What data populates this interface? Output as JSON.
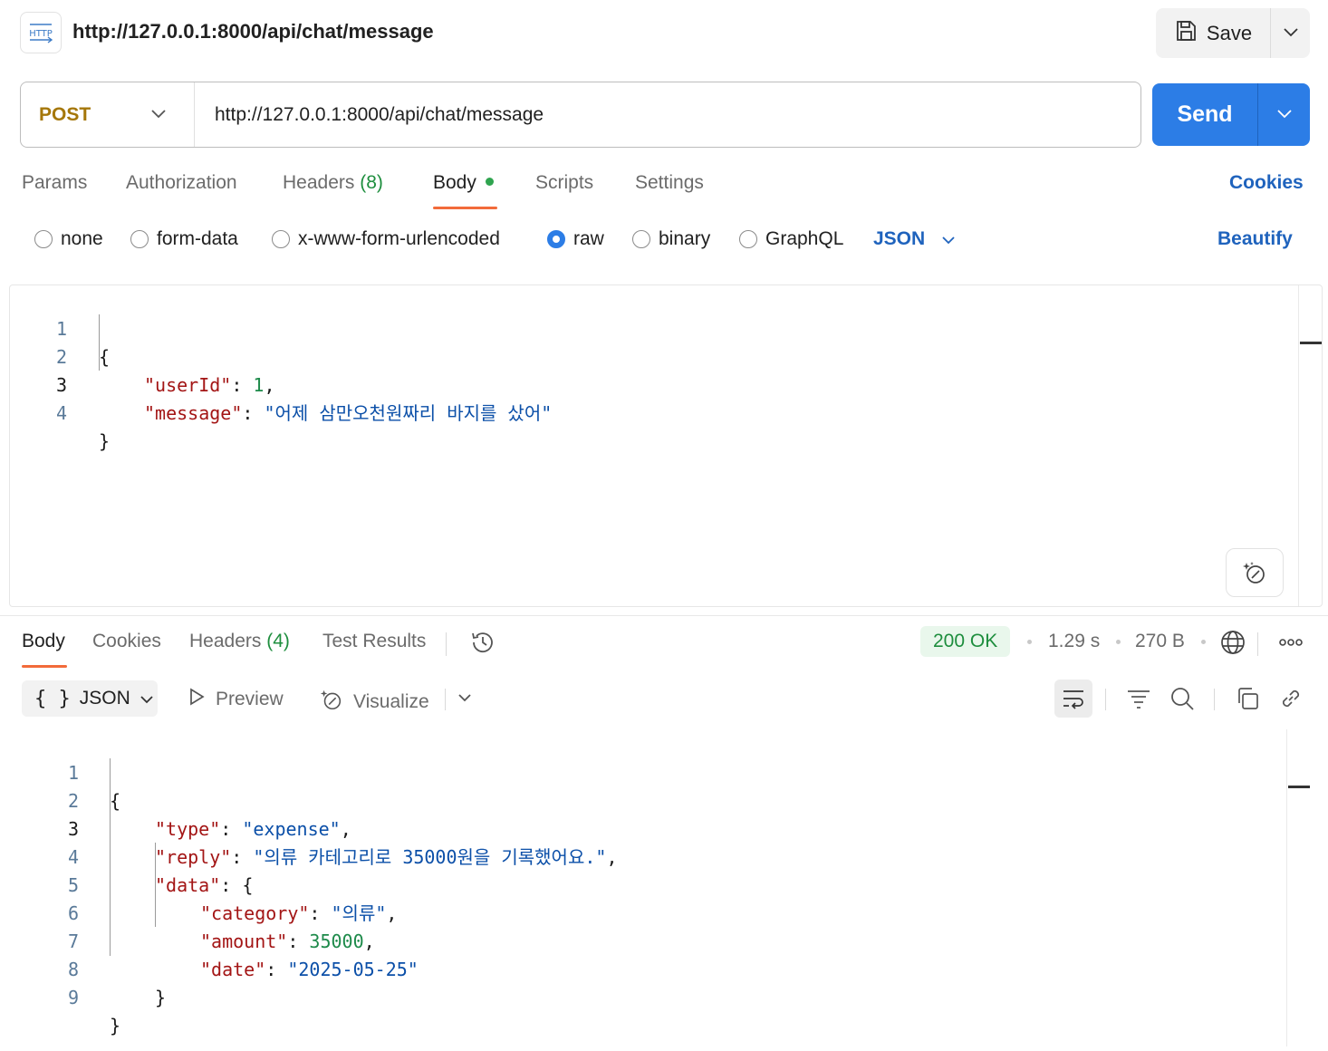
{
  "header": {
    "badge_label": "HTTP",
    "title": "http://127.0.0.1:8000/api/chat/message",
    "save_label": "Save"
  },
  "request": {
    "method": "POST",
    "url": "http://127.0.0.1:8000/api/chat/message",
    "send_label": "Send"
  },
  "request_tabs": {
    "params": "Params",
    "authorization": "Authorization",
    "headers": "Headers",
    "headers_count": "(8)",
    "body": "Body",
    "scripts": "Scripts",
    "settings": "Settings",
    "cookies": "Cookies"
  },
  "body_modes": {
    "none": "none",
    "form_data": "form-data",
    "urlencoded": "x-www-form-urlencoded",
    "raw": "raw",
    "binary": "binary",
    "graphql": "GraphQL",
    "selected": "raw",
    "language": "JSON",
    "beautify": "Beautify"
  },
  "request_body": {
    "line_numbers": [
      "1",
      "2",
      "3",
      "4"
    ],
    "brace_open": "{",
    "brace_close": "}",
    "key_userId": "\"userId\"",
    "val_userId": "1",
    "key_message": "\"message\"",
    "val_message": "\"어제 삼만오천원짜리 바지를 샀어\""
  },
  "response_tabs": {
    "body": "Body",
    "cookies": "Cookies",
    "headers": "Headers",
    "headers_count": "(4)",
    "test_results": "Test Results",
    "status": "200 OK",
    "time": "1.29 s",
    "size": "270 B"
  },
  "response_toolbar": {
    "format": "JSON",
    "preview": "Preview",
    "visualize": "Visualize"
  },
  "response_body": {
    "line_numbers": [
      "1",
      "2",
      "3",
      "4",
      "5",
      "6",
      "7",
      "8",
      "9"
    ],
    "brace_open": "{",
    "brace_close": "}",
    "key_type": "\"type\"",
    "val_type": "\"expense\"",
    "key_reply": "\"reply\"",
    "val_reply": "\"의류 카테고리로 35000원을 기록했어요.\"",
    "key_data": "\"data\"",
    "key_category": "\"category\"",
    "val_category": "\"의류\"",
    "key_amount": "\"amount\"",
    "val_amount": "35000",
    "key_date": "\"date\"",
    "val_date": "\"2025-05-25\""
  },
  "colors": {
    "accent": "#2c7de6",
    "method": "#a5770a",
    "status_ok": "#1e8e3e",
    "tab_underline": "#f26b3a"
  },
  "icons": [
    "http-icon",
    "save-icon",
    "chevron-down-icon",
    "history-icon",
    "globe-icon",
    "more-icon",
    "play-icon",
    "visualize-icon",
    "wrap-icon",
    "filter-icon",
    "search-icon",
    "copy-icon",
    "link-icon",
    "magic-icon"
  ]
}
